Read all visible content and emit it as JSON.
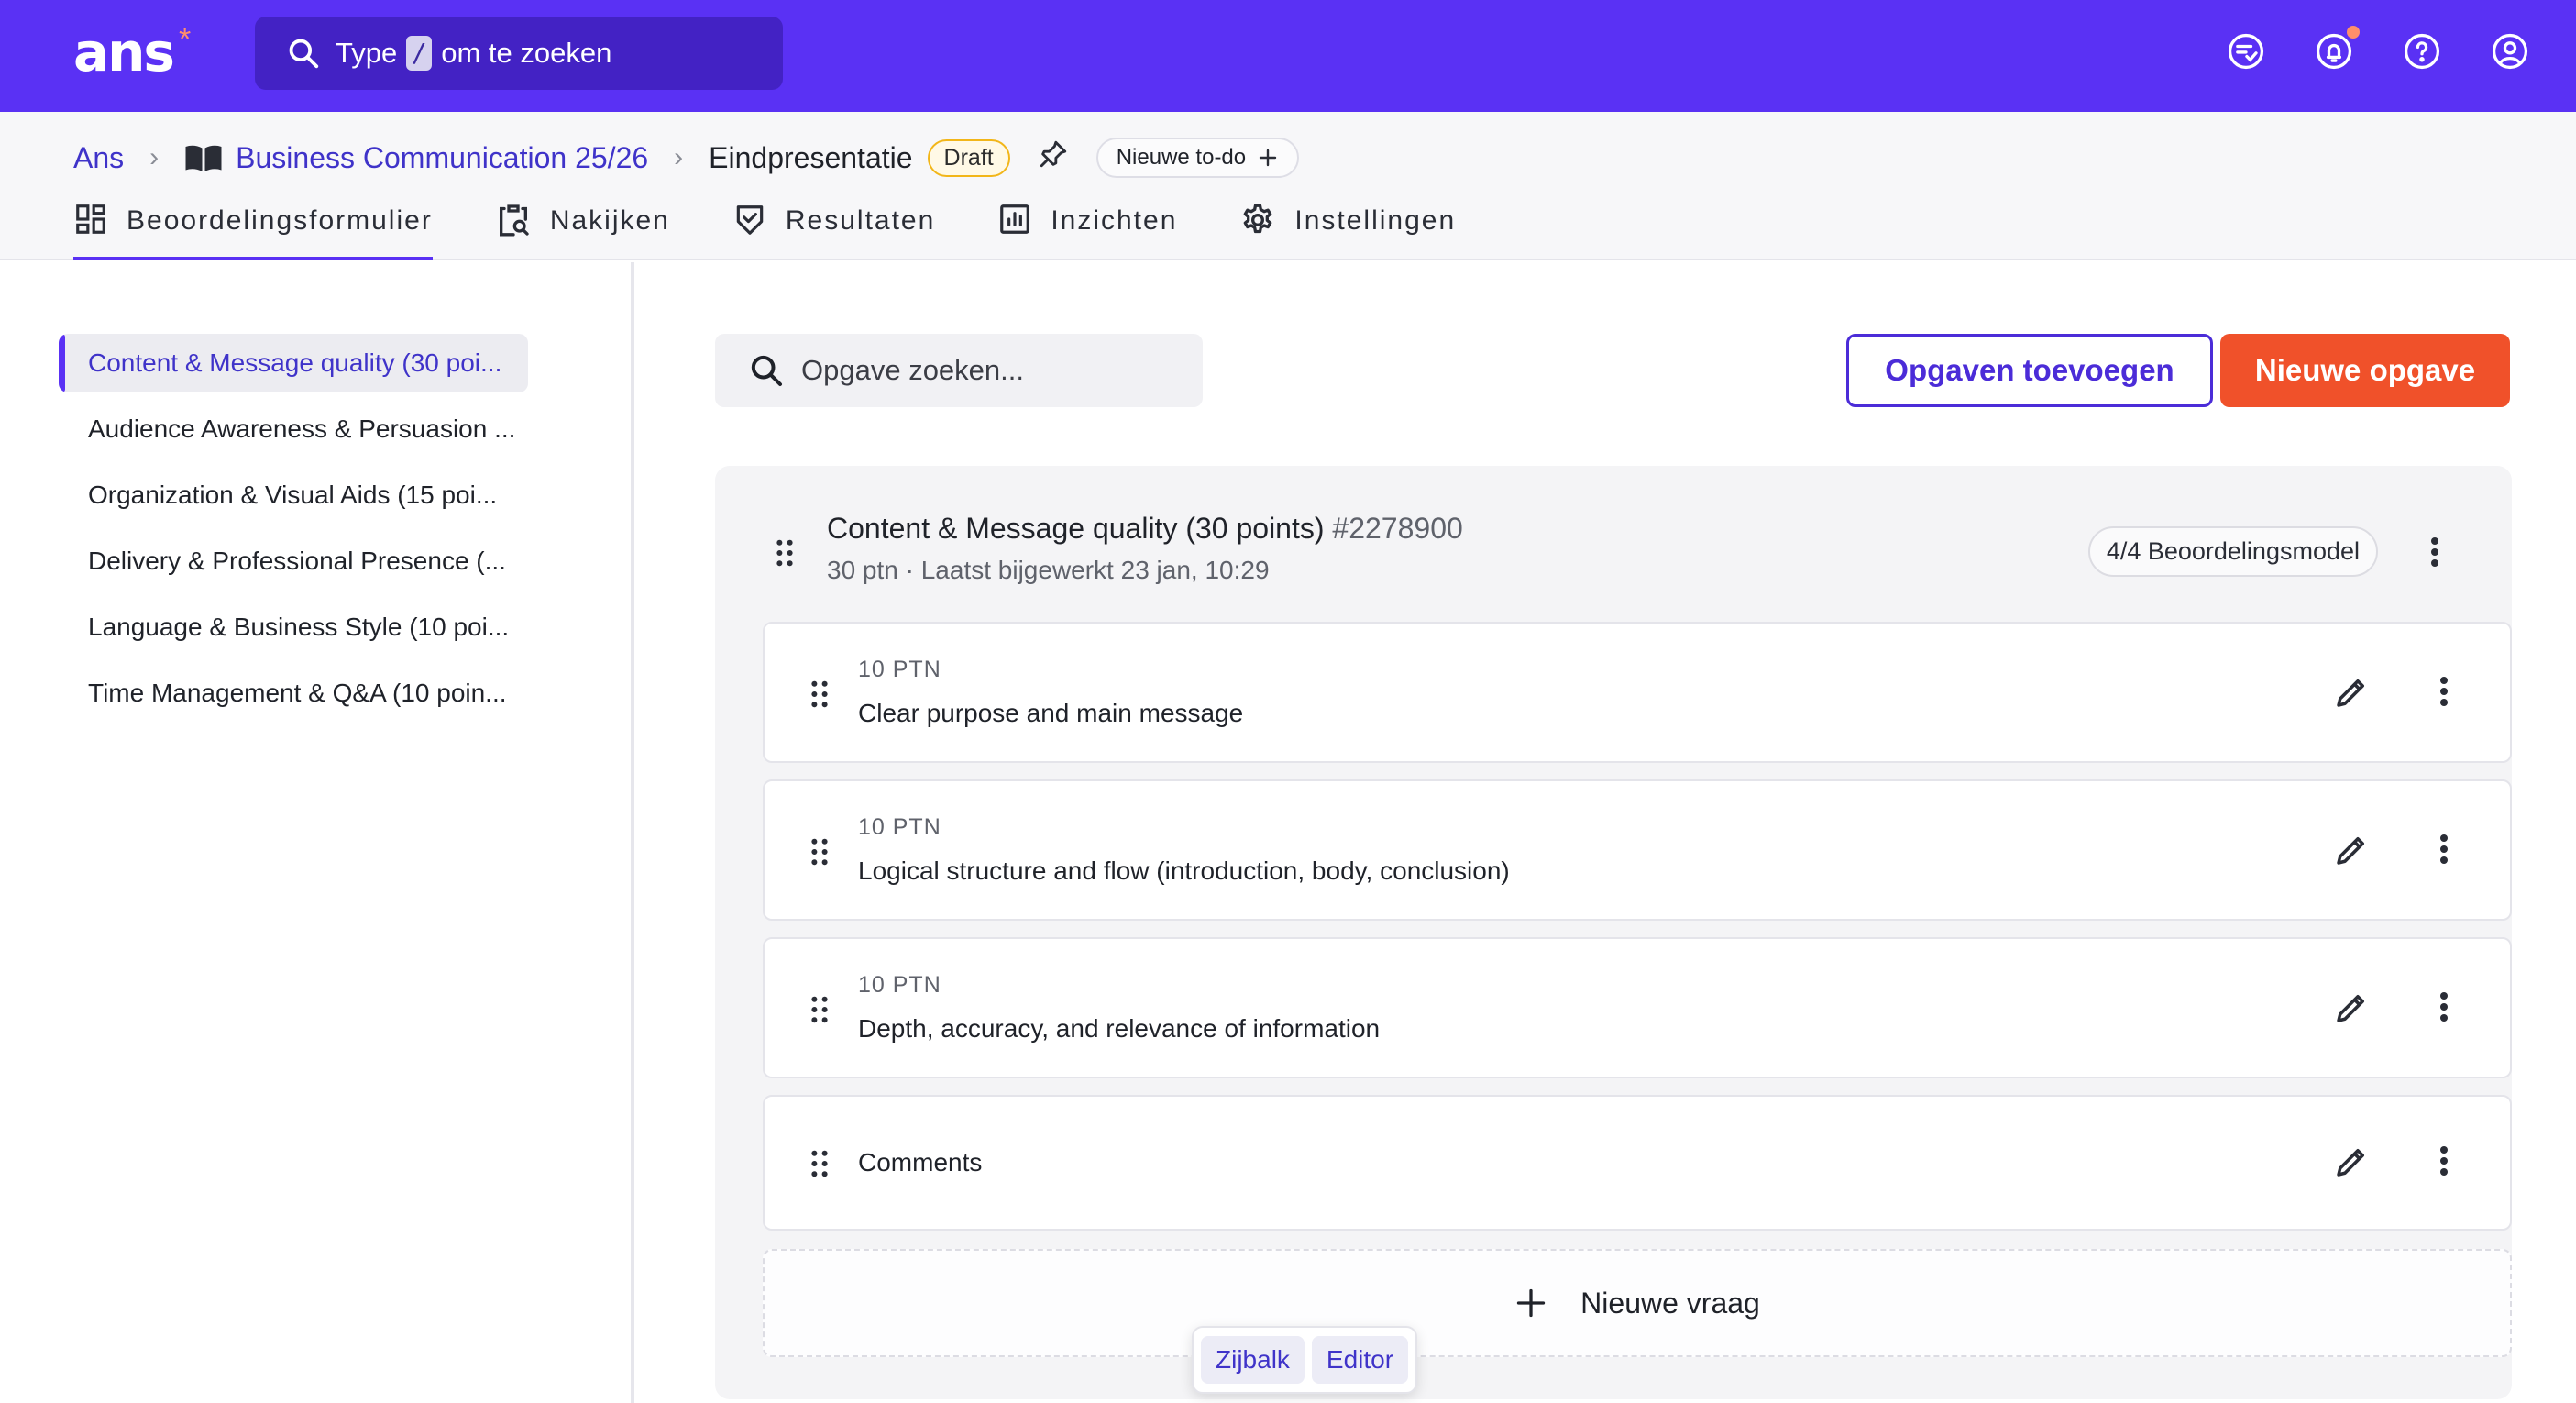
{
  "app": {
    "logo_text": "ans",
    "logo_mark": "*",
    "search": {
      "prefix": "Type",
      "key": "/",
      "suffix": "om te zoeken"
    },
    "top_icons": [
      "tasks-icon",
      "bell-icon",
      "help-icon",
      "user-icon"
    ]
  },
  "breadcrumb": {
    "root": "Ans",
    "course": "Business Communication 25/26",
    "current": "Eindpresentatie",
    "status": "Draft",
    "todo_label": "Nieuwe to-do"
  },
  "tabs": [
    {
      "label": "Beoordelingsformulier",
      "active": true
    },
    {
      "label": "Nakijken"
    },
    {
      "label": "Resultaten"
    },
    {
      "label": "Inzichten"
    },
    {
      "label": "Instellingen"
    }
  ],
  "sidebar": {
    "items": [
      {
        "label": "Content & Message quality (30 poi...",
        "active": true
      },
      {
        "label": "Audience Awareness & Persuasion ..."
      },
      {
        "label": "Organization & Visual Aids (15 poi..."
      },
      {
        "label": "Delivery & Professional Presence (..."
      },
      {
        "label": "Language & Business Style (10 poi..."
      },
      {
        "label": "Time Management & Q&A (10 poin..."
      }
    ]
  },
  "main": {
    "search_placeholder": "Opgave zoeken...",
    "add_existing_label": "Opgaven toevoegen",
    "new_label": "Nieuwe opgave",
    "section": {
      "title": "Content & Message quality (30 points)",
      "id": "#2278900",
      "subtitle": "30 ptn · Laatst bijgewerkt 23 jan, 10:29",
      "model_badge": "4/4 Beoordelingsmodel"
    },
    "questions": [
      {
        "points": "10 PTN",
        "title": "Clear purpose and main message"
      },
      {
        "points": "10 PTN",
        "title": "Logical structure and flow (introduction, body, conclusion)"
      },
      {
        "points": "10 PTN",
        "title": "Depth, accuracy, and relevance of information"
      },
      {
        "points": "",
        "title": "Comments"
      }
    ],
    "new_question_label": "Nieuwe vraag"
  },
  "view_toggle": {
    "sidebar_label": "Zijbalk",
    "editor_label": "Editor"
  },
  "colors": {
    "brand": "#5a31f4",
    "accent": "#f0512a",
    "draft": "#f2b619"
  }
}
